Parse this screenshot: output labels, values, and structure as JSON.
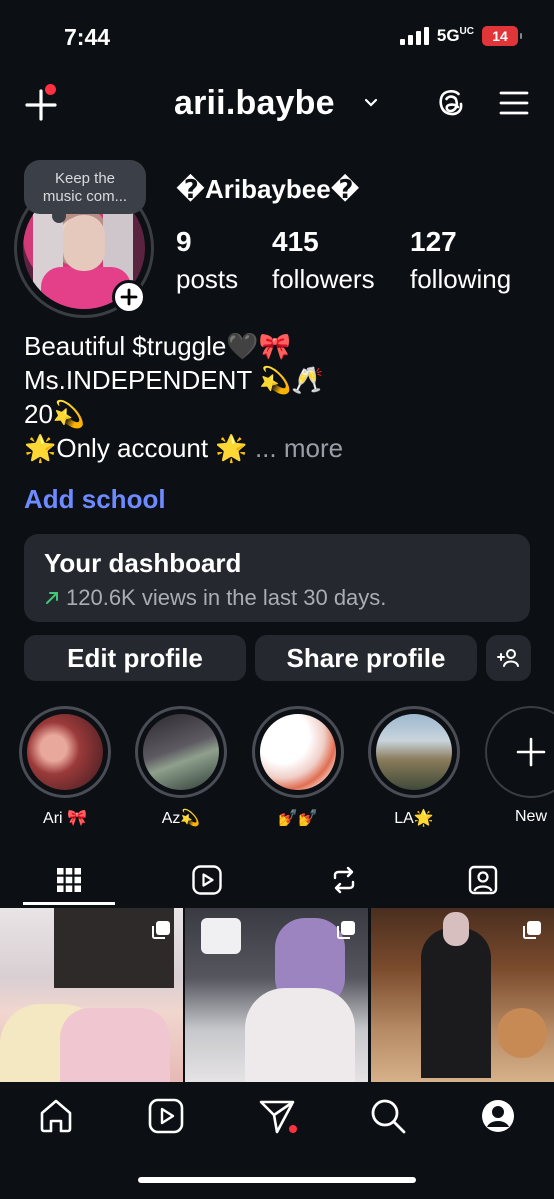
{
  "status_bar": {
    "time": "7:44",
    "network": "5G",
    "network_suffix": "UC",
    "battery": "14"
  },
  "header": {
    "username": "arii.baybe"
  },
  "profile": {
    "note_line1": "Keep the",
    "note_line2": "music com...",
    "display_name": "�Aribaybee�",
    "stats": {
      "posts_count": "9",
      "posts_label": "posts",
      "followers_count": "415",
      "followers_label": "followers",
      "following_count": "127",
      "following_label": "following"
    },
    "bio": [
      "Beautiful $truggle🖤🎀",
      "Ms.INDEPENDENT 💫🥂",
      "20💫",
      "🌟Only account 🌟"
    ],
    "more_label": "... more",
    "add_school": "Add school"
  },
  "dashboard": {
    "title": "Your dashboard",
    "subtitle": "120.6K views in the last 30 days."
  },
  "buttons": {
    "edit": "Edit profile",
    "share": "Share profile"
  },
  "highlights": [
    {
      "label": "Ari 🎀"
    },
    {
      "label": "Az💫"
    },
    {
      "label": "💅💅"
    },
    {
      "label": "LA🌟"
    },
    {
      "label": "New"
    }
  ],
  "tabs": [
    "grid-icon",
    "reels-icon",
    "reposts-icon",
    "tagged-icon"
  ],
  "nav": [
    "home-icon",
    "reels-icon",
    "messages-icon",
    "search-icon",
    "profile-icon"
  ],
  "colors": {
    "accent_link": "#6d8bff",
    "notification": "#ff3040",
    "battery": "#e0363a",
    "background": "#0c0f14",
    "card": "#25282e"
  }
}
